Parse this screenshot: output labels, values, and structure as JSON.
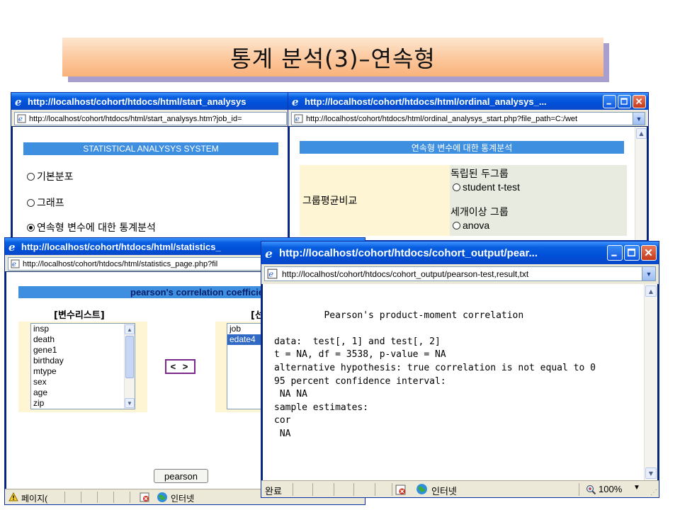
{
  "slide_title": "통계 분석(3)–연속형",
  "win_start": {
    "title": "http://localhost/cohort/htdocs/html/start_analysys",
    "address": "http://localhost/cohort/htdocs/html/start_analysys.htm?job_id=",
    "header": "STATISTICAL ANALYSYS SYSTEM",
    "options": [
      "기본분포",
      "그래프",
      "연속형 변수에 대한 통계분석"
    ],
    "selected_index": 2
  },
  "win_ordinal": {
    "title": "http://localhost/cohort/htdocs/html/ordinal_analysys_...",
    "address": "http://localhost/cohort/htdocs/html/ordinal_analysys_start.php?file_path=C:/wet",
    "header": "연속형 변수에 대한 통계분석",
    "row_label": "그룹평균비교",
    "group1_label": "독립된 두그룹",
    "group1_option": "student t-test",
    "group2_label": "세개이상 그룹",
    "group2_option": "anova"
  },
  "win_stats": {
    "title": "http://localhost/cohort/htdocs/html/statistics_",
    "address": "http://localhost/cohort/htdocs/html/statistics_page.php?fil",
    "header": "pearson's correlation coefficien",
    "var_list_label": "[변수리스트]",
    "sel_list_label": "[선",
    "variables": [
      "insp",
      "death",
      "gene1",
      "birthday",
      "mtype",
      "sex",
      "age",
      "zip"
    ],
    "selected_vars": [
      "job",
      "edate4"
    ],
    "selected_var_highlight": 1,
    "move_button": "< >",
    "pearson_button": "pearson",
    "status_text": "페이지(",
    "zone_text": "인터넷"
  },
  "win_output": {
    "title": "http://localhost/cohort/htdocs/cohort_output/pear...",
    "address": "http://localhost/cohort/htdocs/cohort_output/pearson-test,result,txt",
    "lines": [
      "         Pearson's product-moment correlation",
      "",
      "data:  test[, 1] and test[, 2]",
      "t = NA, df = 3538, p-value = NA",
      "alternative hypothesis: true correlation is not equal to 0",
      "95 percent confidence interval:",
      " NA NA",
      "sample estimates:",
      "cor",
      " NA"
    ],
    "status_text": "완료",
    "zone_text": "인터넷",
    "zoom": "100%"
  }
}
